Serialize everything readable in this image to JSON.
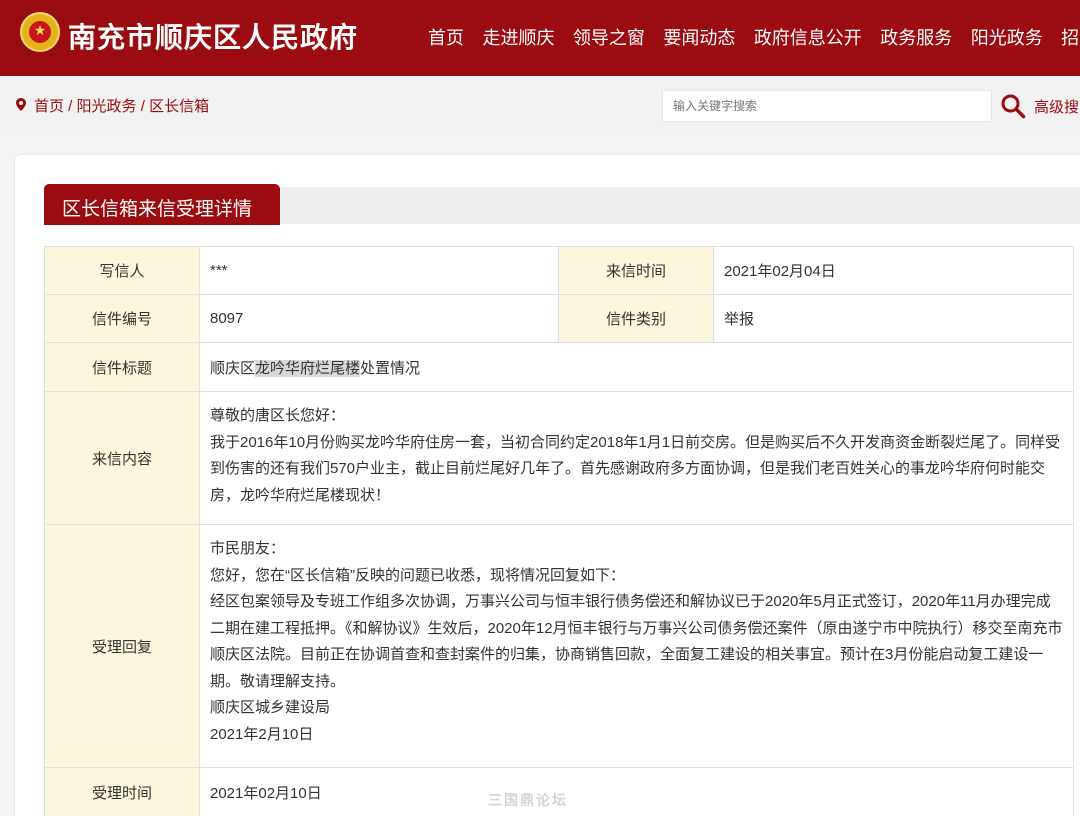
{
  "header": {
    "site_title": "南充市顺庆区人民政府",
    "nav": [
      "首页",
      "走进顺庆",
      "领导之窗",
      "要闻动态",
      "政府信息公开",
      "政务服务",
      "阳光政务",
      "招商引资"
    ]
  },
  "breadcrumb": {
    "home": "首页",
    "section": "阳光政务",
    "current": "区长信箱",
    "separator": " / "
  },
  "search": {
    "placeholder": "输入关键字搜索",
    "advanced_label": "高级搜索"
  },
  "page_tab": "区长信箱来信受理详情",
  "letter": {
    "writer_label": "写信人",
    "writer_value": "***",
    "date_label": "来信时间",
    "date_value": "2021年02月04日",
    "number_label": "信件编号",
    "number_value": "8097",
    "category_label": "信件类别",
    "category_value": "举报",
    "subject_label": "信件标题",
    "subject_pre": "顺庆区",
    "subject_highlight": "龙吟华府烂尾楼",
    "subject_post": "处置情况",
    "content_label": "来信内容",
    "content_lines": [
      "尊敬的唐区长您好：",
      "我于2016年10月份购买龙吟华府住房一套，当初合同约定2018年1月1日前交房。但是购买后不久开发商资金断裂烂尾了。同样受到伤害的还有我们570户业主，截止目前烂尾好几年了。首先感谢政府多方面协调，但是我们老百姓关心的事龙吟华府何时能交房，龙吟华府烂尾楼现状！"
    ],
    "reply_label": "受理回复",
    "reply_lines": [
      "市民朋友：",
      "您好，您在“区长信箱”反映的问题已收悉，现将情况回复如下：",
      "经区包案领导及专班工作组多次协调，万事兴公司与恒丰银行债务偿还和解协议已于2020年5月正式签订，2020年11月办理完成二期在建工程抵押。《和解协议》生效后，2020年12月恒丰银行与万事兴公司债务偿还案件（原由遂宁市中院执行）移交至南充市顺庆区法院。目前正在协调首查和查封案件的归集，协商销售回款，全面复工建设的相关事宜。预计在3月份能启动复工建设一期。敬请理解支持。",
      "顺庆区城乡建设局",
      "2021年2月10日"
    ],
    "reply_time_label": "受理时间",
    "reply_time_value": "2021年02月10日"
  },
  "watermark": "三国鼎论坛",
  "colors": {
    "brand": "#9b0c10",
    "label_bg": "#fcf7dc",
    "highlight": "#d8d8d8"
  }
}
